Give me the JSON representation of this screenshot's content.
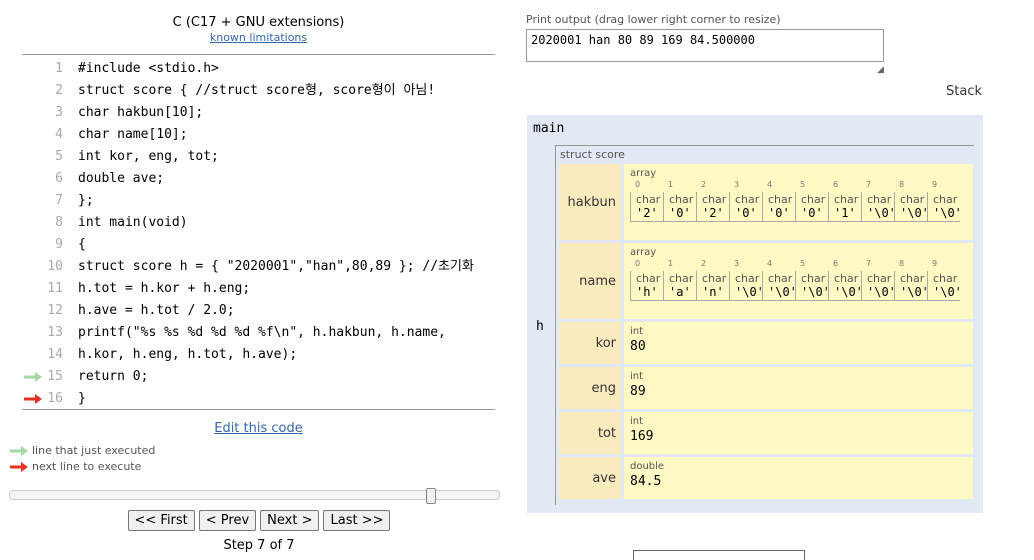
{
  "header": {
    "language": "C (C17 + GNU extensions)",
    "limitations_link": "known limitations"
  },
  "code_lines": [
    {
      "num": "1",
      "text": "#include <stdio.h>",
      "arrow": ""
    },
    {
      "num": "2",
      "text": "struct score { //struct score형, score형이 아님!",
      "arrow": ""
    },
    {
      "num": "3",
      "text": "char hakbun[10];",
      "arrow": ""
    },
    {
      "num": "4",
      "text": "char name[10];",
      "arrow": ""
    },
    {
      "num": "5",
      "text": "int kor, eng, tot;",
      "arrow": ""
    },
    {
      "num": "6",
      "text": "double ave;",
      "arrow": ""
    },
    {
      "num": "7",
      "text": "};",
      "arrow": ""
    },
    {
      "num": "8",
      "text": "int main(void)",
      "arrow": ""
    },
    {
      "num": "9",
      "text": "{",
      "arrow": ""
    },
    {
      "num": "10",
      "text": "struct score h = { \"2020001\",\"han\",80,89 }; //초기화",
      "arrow": ""
    },
    {
      "num": "11",
      "text": "h.tot = h.kor + h.eng;",
      "arrow": ""
    },
    {
      "num": "12",
      "text": "h.ave = h.tot / 2.0;",
      "arrow": ""
    },
    {
      "num": "13",
      "text": "printf(\"%s %s %d %d %d %f\\n\", h.hakbun, h.name,",
      "arrow": ""
    },
    {
      "num": "14",
      "text": "h.kor, h.eng, h.tot, h.ave);",
      "arrow": ""
    },
    {
      "num": "15",
      "text": "return 0;",
      "arrow": "just-executed"
    },
    {
      "num": "16",
      "text": "}",
      "arrow": "next"
    }
  ],
  "edit_link": "Edit this code",
  "legend": {
    "executed": "line that just executed",
    "next": "next line to execute"
  },
  "colors": {
    "executed_arrow": "#a6d8a6",
    "next_arrow": "#e33222",
    "frame_bg": "#e2e8f4",
    "field_name_bg": "#faebbf",
    "field_value_bg": "#fff9c4"
  },
  "slider": {
    "position": 0.86
  },
  "nav": {
    "first": "<< First",
    "prev": "< Prev",
    "next": "Next >",
    "last": "Last >>"
  },
  "step": "Step 7 of 7",
  "print_output": {
    "label": "Print output (drag lower right corner to resize)",
    "text": "2020001 han 80 89 169 84.500000"
  },
  "stack": {
    "heading": "Stack",
    "frame_name": "main",
    "var_name": "h",
    "struct_label": "struct score",
    "fields": [
      {
        "name": "hakbun",
        "type": "array",
        "elem_type": "char",
        "indices": [
          "0",
          "1",
          "2",
          "3",
          "4",
          "5",
          "6",
          "7",
          "8",
          "9"
        ],
        "values": [
          "'2'",
          "'0'",
          "'2'",
          "'0'",
          "'0'",
          "'0'",
          "'1'",
          "'\\0'",
          "'\\0'",
          "'\\0'"
        ]
      },
      {
        "name": "name",
        "type": "array",
        "elem_type": "char",
        "indices": [
          "0",
          "1",
          "2",
          "3",
          "4",
          "5",
          "6",
          "7",
          "8",
          "9"
        ],
        "values": [
          "'h'",
          "'a'",
          "'n'",
          "'\\0'",
          "'\\0'",
          "'\\0'",
          "'\\0'",
          "'\\0'",
          "'\\0'",
          "'\\0'"
        ]
      },
      {
        "name": "kor",
        "type": "int",
        "value": "80"
      },
      {
        "name": "eng",
        "type": "int",
        "value": "89"
      },
      {
        "name": "tot",
        "type": "int",
        "value": "169"
      },
      {
        "name": "ave",
        "type": "double",
        "value": "84.5"
      }
    ]
  }
}
